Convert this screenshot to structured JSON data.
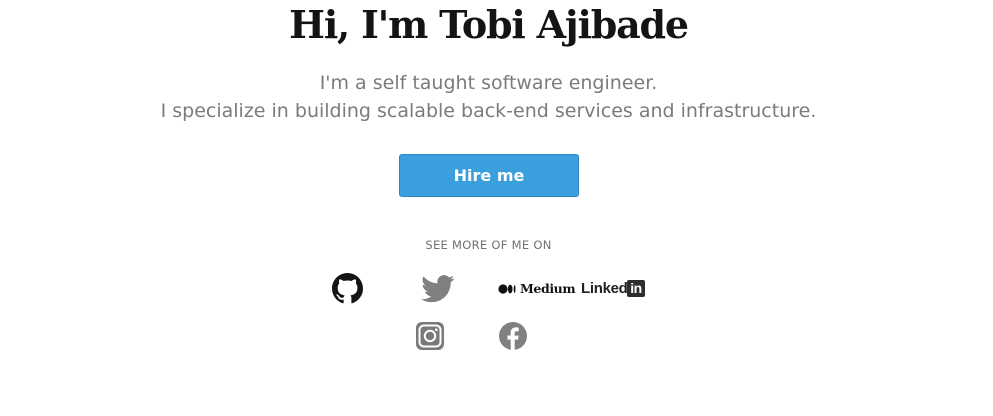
{
  "hero": {
    "title": "Hi, I'm Tobi Ajibade",
    "subtitle_line1": "I'm a self taught software engineer.",
    "subtitle_line2": "I specialize in building scalable back-end services and infrastructure.",
    "cta_label": "Hire me"
  },
  "social": {
    "heading": "SEE MORE OF ME ON",
    "medium_label": "Medium",
    "linkedin_label": "Linked",
    "linkedin_box": "in",
    "icons": [
      "github-icon",
      "twitter-icon",
      "medium-logo",
      "linkedin-logo",
      "instagram-icon",
      "facebook-icon"
    ]
  },
  "colors": {
    "button_bg": "#3b9fdd",
    "button_border": "#2f86c3",
    "title": "#141414",
    "subtitle": "#7b7b7b",
    "icon_gray": "#808080"
  }
}
